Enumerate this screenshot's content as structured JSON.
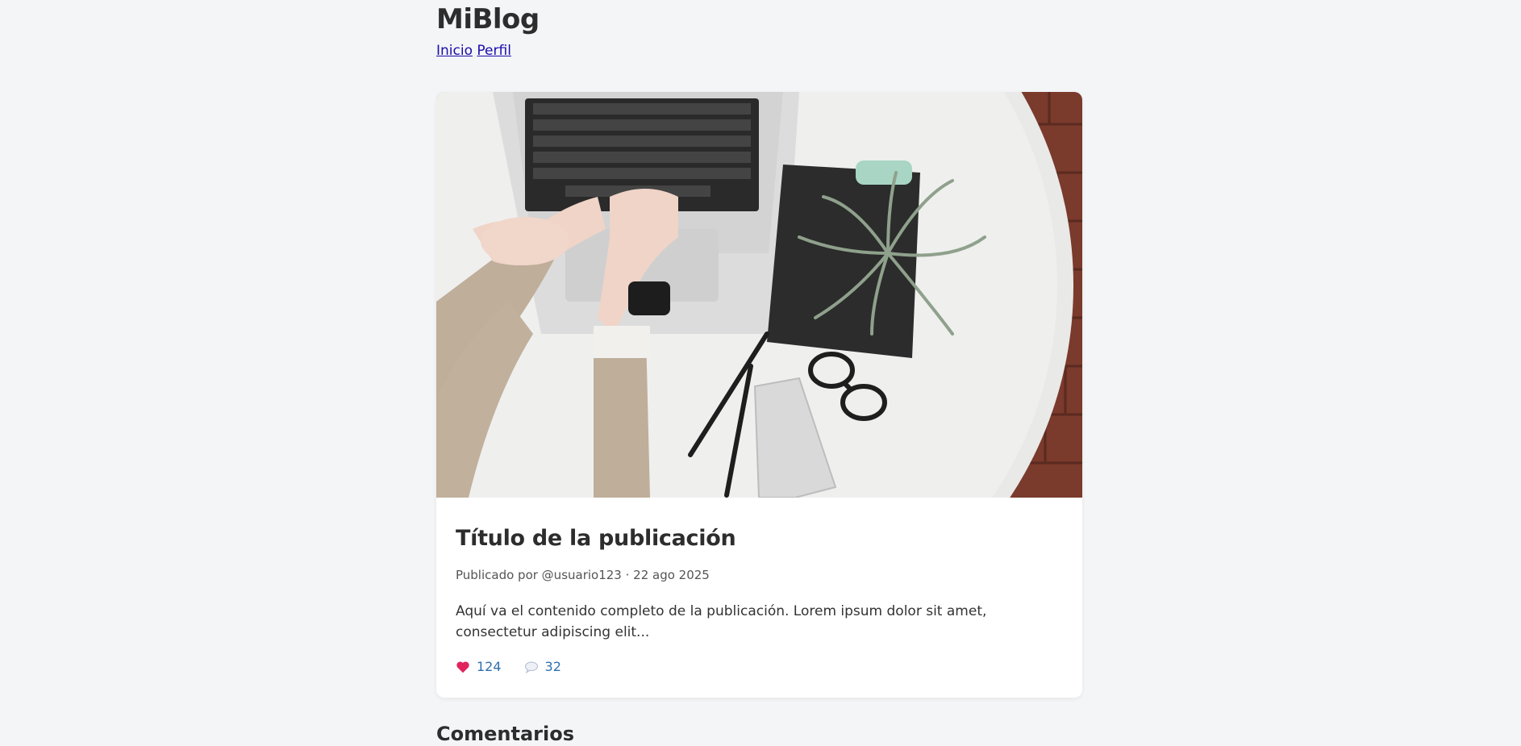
{
  "header": {
    "brand": "MiBlog",
    "nav": [
      {
        "label": "Inicio"
      },
      {
        "label": "Perfil"
      }
    ]
  },
  "post": {
    "image_alt": "Manos escribiendo en un portátil sobre una mesa blanca con planta, gafas, lápices y móvil",
    "title": "Título de la publicación",
    "meta": "Publicado por @usuario123 · 22 ago 2025",
    "content": "Aquí va el contenido completo de la publicación. Lorem ipsum dolor sit amet, consectetur adipiscing elit...",
    "likes": "124",
    "comments": "32",
    "like_icon": "heart-icon",
    "comment_icon": "speech-bubble-icon"
  },
  "comments_section": {
    "heading": "Comentarios"
  },
  "colors": {
    "background": "#f4f5f7",
    "link": "#1a0dab",
    "action": "#2f6fae",
    "heart": "#e0245e"
  }
}
